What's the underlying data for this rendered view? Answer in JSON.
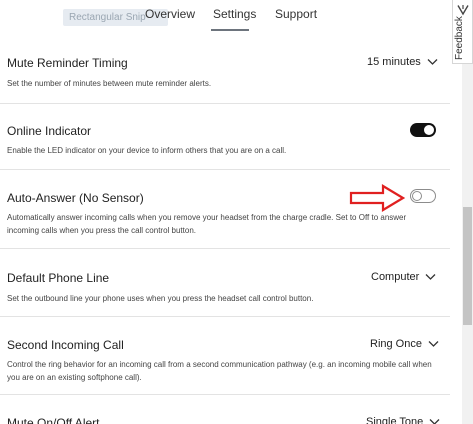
{
  "header": {
    "ghost_chip": "Rectangular Snip",
    "tabs": [
      {
        "label": "Overview"
      },
      {
        "label": "Settings"
      },
      {
        "label": "Support"
      }
    ],
    "active_tab": "Settings"
  },
  "feedback": {
    "label": "Feedback",
    "icon": "flag-icon"
  },
  "settings": [
    {
      "title": "Mute Reminder Timing",
      "description": "Set the number of minutes between mute reminder alerts.",
      "control": "dropdown",
      "value": "15 minutes"
    },
    {
      "title": "Online Indicator",
      "description": "Enable the LED indicator on your device to inform others that you are on a call.",
      "control": "toggle",
      "state": "on"
    },
    {
      "title": "Auto-Answer (No Sensor)",
      "description": "Automatically answer incoming calls when you remove your headset from the charge cradle. Set to Off to answer incoming calls when you press the call control button.",
      "control": "toggle",
      "state": "off"
    },
    {
      "title": "Default Phone Line",
      "description": "Set the outbound line your phone uses when you press the headset call control button.",
      "control": "dropdown",
      "value": "Computer"
    },
    {
      "title": "Second Incoming Call",
      "description": "Control the ring behavior for an incoming call from a second communication pathway (e.g. an incoming mobile call when you are on an existing softphone call).",
      "control": "dropdown",
      "value": "Ring Once"
    },
    {
      "title": "Mute On/Off Alert",
      "control": "dropdown",
      "value": "Single Tone"
    }
  ],
  "colors": {
    "toggle_on": "#111111",
    "annotation_arrow": "#e02020",
    "divider": "#e3e3e3"
  }
}
